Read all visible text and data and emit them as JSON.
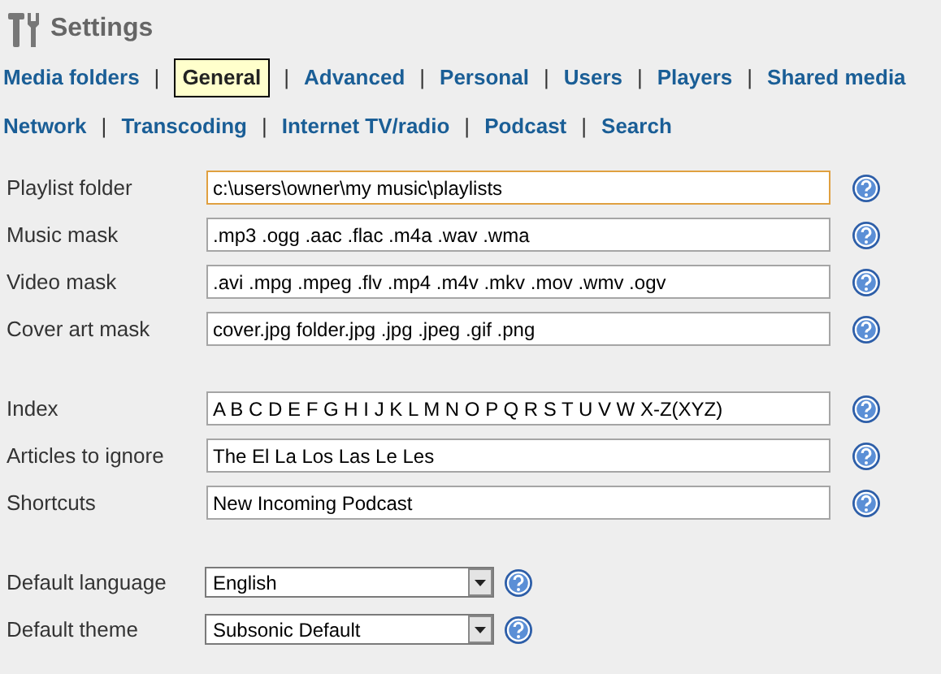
{
  "header": {
    "title": "Settings"
  },
  "nav": {
    "separator": "|",
    "rows": [
      [
        {
          "label": "Media folders",
          "selected": false
        },
        {
          "label": "General",
          "selected": true
        },
        {
          "label": "Advanced",
          "selected": false
        },
        {
          "label": "Personal",
          "selected": false
        },
        {
          "label": "Users",
          "selected": false
        },
        {
          "label": "Players",
          "selected": false
        },
        {
          "label": "Shared media",
          "selected": false
        }
      ],
      [
        {
          "label": "Network",
          "selected": false
        },
        {
          "label": "Transcoding",
          "selected": false
        },
        {
          "label": "Internet TV/radio",
          "selected": false
        },
        {
          "label": "Podcast",
          "selected": false
        },
        {
          "label": "Search",
          "selected": false
        }
      ]
    ]
  },
  "groups": [
    [
      {
        "kind": "text",
        "label": "Playlist folder",
        "value": "c:\\users\\owner\\my music\\playlists",
        "focused": true
      },
      {
        "kind": "text",
        "label": "Music mask",
        "value": ".mp3 .ogg .aac .flac .m4a .wav .wma",
        "focused": false
      },
      {
        "kind": "text",
        "label": "Video mask",
        "value": ".avi .mpg .mpeg .flv .mp4 .m4v .mkv .mov .wmv .ogv",
        "focused": false
      },
      {
        "kind": "text",
        "label": "Cover art mask",
        "value": "cover.jpg folder.jpg .jpg .jpeg .gif .png",
        "focused": false
      }
    ],
    [
      {
        "kind": "text",
        "label": "Index",
        "value": "A B C D E F G H I J K L M N O P Q R S T U V W X-Z(XYZ)",
        "focused": false
      },
      {
        "kind": "text",
        "label": "Articles to ignore",
        "value": "The El La Los Las Le Les",
        "focused": false
      },
      {
        "kind": "text",
        "label": "Shortcuts",
        "value": "New Incoming Podcast",
        "focused": false
      }
    ],
    [
      {
        "kind": "select",
        "label": "Default language",
        "value": "English"
      },
      {
        "kind": "select",
        "label": "Default theme",
        "value": "Subsonic Default"
      }
    ]
  ]
}
